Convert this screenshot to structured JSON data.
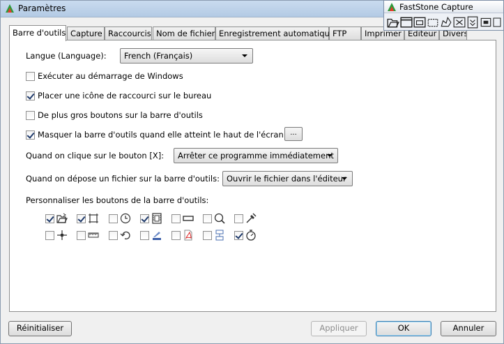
{
  "window": {
    "title": "Paramètres"
  },
  "tabs": [
    {
      "label": "Barre d'outils"
    },
    {
      "label": "Capture"
    },
    {
      "label": "Raccourcis"
    },
    {
      "label": "Nom de fichier"
    },
    {
      "label": "Enregistrement automatique"
    },
    {
      "label": "FTP"
    },
    {
      "label": "Imprimer"
    },
    {
      "label": "Éditeur"
    },
    {
      "label": "Divers"
    }
  ],
  "settings": {
    "language_label": "Langue (Language):",
    "language_value": "French (Français)",
    "run_at_startup_label": "Exécuter au démarrage de Windows",
    "run_at_startup_checked": false,
    "desktop_shortcut_label": "Placer une icône de raccourci sur le bureau",
    "desktop_shortcut_checked": true,
    "big_buttons_label": "De plus gros boutons sur la barre d'outils",
    "big_buttons_checked": false,
    "autohide_label": "Masquer la barre d'outils quand elle atteint le haut de l'écran",
    "autohide_checked": true,
    "autohide_more_label": "...",
    "click_x_label": "Quand on clique sur le bouton [X]:",
    "click_x_value": "Arrêter ce programme immédiatement",
    "drop_file_label": "Quand on dépose un fichier sur la barre d'outils:",
    "drop_file_value": "Ouvrir le fichier dans l'éditeur",
    "customize_label": "Personnaliser les boutons de la barre d'outils:"
  },
  "toolbar_buttons": [
    {
      "icon": "folder-open-icon",
      "checked": true
    },
    {
      "icon": "capture-rectangle-icon",
      "checked": true
    },
    {
      "icon": "delayed-capture-icon",
      "checked": false
    },
    {
      "icon": "screen-video-icon",
      "checked": true
    },
    {
      "icon": "fixed-region-icon",
      "checked": false
    },
    {
      "icon": "magnifier-icon",
      "checked": false
    },
    {
      "icon": "color-picker-icon",
      "checked": false
    },
    {
      "icon": "crosshair-icon",
      "checked": false
    },
    {
      "icon": "screen-ruler-icon",
      "checked": false
    },
    {
      "icon": "undo-icon",
      "checked": false
    },
    {
      "icon": "scanner-icon",
      "checked": false
    },
    {
      "icon": "pdf-icon",
      "checked": false
    },
    {
      "icon": "scrolling-window-icon",
      "checked": false
    },
    {
      "icon": "timer-icon",
      "checked": true
    }
  ],
  "footer": {
    "reset_label": "Réinitialiser",
    "apply_label": "Appliquer",
    "ok_label": "OK",
    "cancel_label": "Annuler"
  },
  "faststone": {
    "title": "FastStone Capture",
    "icons": [
      "open-icon",
      "capture-window-icon",
      "capture-object-icon",
      "capture-rectangle-icon",
      "capture-freehand-icon",
      "capture-fullscreen-icon",
      "scrolling-window-icon",
      "fixed-region-icon",
      "more-icon"
    ]
  },
  "colors": {
    "title_bar": "#c9dbef",
    "default_button_border": "#3c7fb1"
  }
}
